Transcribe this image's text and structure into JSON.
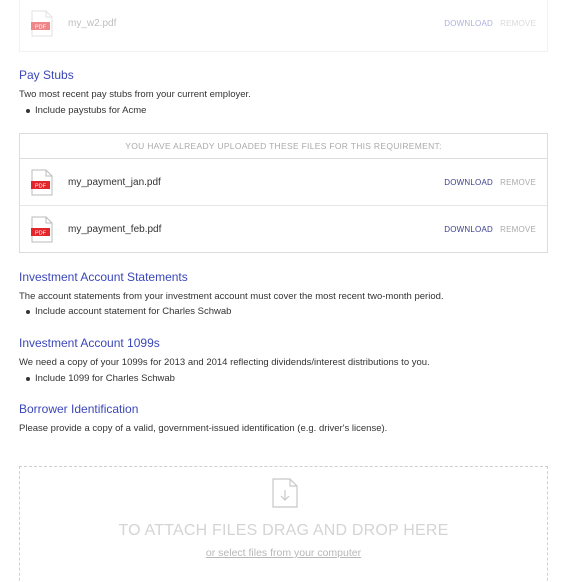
{
  "top_file": {
    "name": "my_w2.pdf",
    "icon": "pdf-icon",
    "download": "DOWNLOAD",
    "remove": "REMOVE",
    "icon_label": "PDF"
  },
  "pay_stubs": {
    "title": "Pay Stubs",
    "description": "Two most recent pay stubs from your current employer.",
    "bullets": [
      "Include paystubs for Acme"
    ],
    "uploaded_header": "YOU HAVE ALREADY UPLOADED THESE FILES FOR THIS REQUIREMENT:",
    "files": [
      {
        "name": "my_payment_jan.pdf",
        "download": "DOWNLOAD",
        "remove": "REMOVE",
        "icon_label": "PDF"
      },
      {
        "name": "my_payment_feb.pdf",
        "download": "DOWNLOAD",
        "remove": "REMOVE",
        "icon_label": "PDF"
      }
    ]
  },
  "investment_statements": {
    "title": "Investment Account Statements",
    "description": "The account statements from your investment account must cover the most recent two-month period.",
    "bullets": [
      "Include account statement for Charles Schwab"
    ]
  },
  "investment_1099": {
    "title": "Investment Account 1099s",
    "description": "We need a copy of your 1099s for 2013 and 2014 reflecting dividends/interest distributions to you.",
    "bullets": [
      "Include 1099 for Charles Schwab"
    ]
  },
  "borrower_id": {
    "title": "Borrower Identification",
    "description": "Please provide a copy of a valid, government-issued identification (e.g. driver's license)."
  },
  "dropzone": {
    "icon": "file-download-icon",
    "title": "TO ATTACH FILES DRAG AND DROP HERE",
    "link": "or select files from your computer"
  },
  "colors": {
    "accent": "#3b47b8",
    "pdf_red": "#e3252c",
    "link_dark": "#3b3f8c"
  }
}
